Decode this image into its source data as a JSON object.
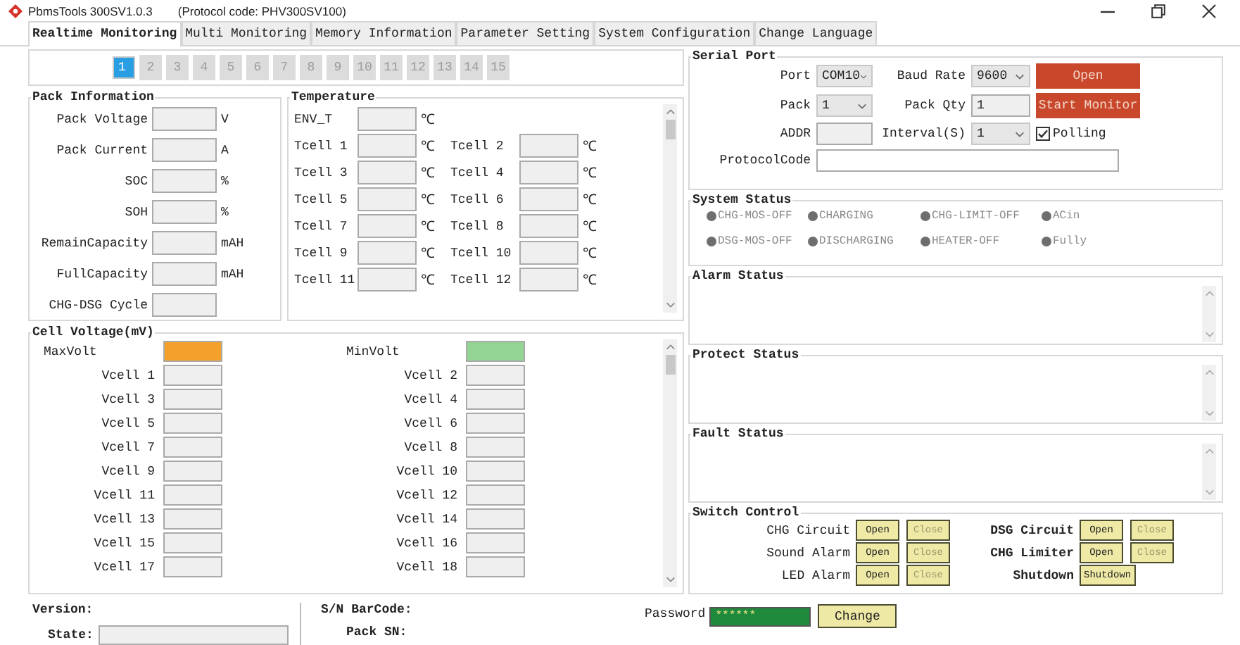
{
  "window": {
    "title": "PbmsTools 300SV1.0.3",
    "protocol": "(Protocol code: PHV300SV100)"
  },
  "tabs": [
    {
      "label": "Realtime Monitoring",
      "selected": true
    },
    {
      "label": "Multi Monitoring",
      "selected": false
    },
    {
      "label": "Memory Information",
      "selected": false
    },
    {
      "label": "Parameter Setting",
      "selected": false
    },
    {
      "label": "System Configuration",
      "selected": false
    },
    {
      "label": "Change Language",
      "selected": false
    }
  ],
  "pack_pages": [
    {
      "label": "1",
      "selected": true
    },
    {
      "label": "2",
      "selected": false
    },
    {
      "label": "3",
      "selected": false
    },
    {
      "label": "4",
      "selected": false
    },
    {
      "label": "5",
      "selected": false
    },
    {
      "label": "6",
      "selected": false
    },
    {
      "label": "7",
      "selected": false
    },
    {
      "label": "8",
      "selected": false
    },
    {
      "label": "9",
      "selected": false
    },
    {
      "label": "10",
      "selected": false
    },
    {
      "label": "11",
      "selected": false
    },
    {
      "label": "12",
      "selected": false
    },
    {
      "label": "13",
      "selected": false
    },
    {
      "label": "14",
      "selected": false
    },
    {
      "label": "15",
      "selected": false
    }
  ],
  "pack_information": {
    "title": "Pack Information",
    "fields": [
      {
        "label": "Pack Voltage",
        "unit": "V"
      },
      {
        "label": "Pack Current",
        "unit": "A"
      },
      {
        "label": "SOC",
        "unit": "%"
      },
      {
        "label": "SOH",
        "unit": "%"
      },
      {
        "label": "RemainCapacity",
        "unit": "mAH"
      },
      {
        "label": "FullCapacity",
        "unit": "mAH"
      },
      {
        "label": "CHG-DSG Cycle"
      }
    ]
  },
  "temperature": {
    "title": "Temperature",
    "rows": [
      [
        {
          "label": "ENV_T",
          "unit": "℃"
        }
      ],
      [
        {
          "label": "Tcell 1",
          "unit": "℃"
        },
        {
          "label": "Tcell 2",
          "unit": "℃"
        }
      ],
      [
        {
          "label": "Tcell 3",
          "unit": "℃"
        },
        {
          "label": "Tcell 4",
          "unit": "℃"
        }
      ],
      [
        {
          "label": "Tcell 5",
          "unit": "℃"
        },
        {
          "label": "Tcell 6",
          "unit": "℃"
        }
      ],
      [
        {
          "label": "Tcell 7",
          "unit": "℃"
        },
        {
          "label": "Tcell 8",
          "unit": "℃"
        }
      ],
      [
        {
          "label": "Tcell 9",
          "unit": "℃"
        },
        {
          "label": "Tcell 10",
          "unit": "℃"
        }
      ],
      [
        {
          "label": "Tcell 11",
          "unit": "℃"
        },
        {
          "label": "Tcell 12",
          "unit": "℃"
        }
      ]
    ]
  },
  "cell_voltage": {
    "title": "Cell Voltage(mV)",
    "max": {
      "label": "MaxVolt",
      "color": "#f4a12c"
    },
    "min": {
      "label": "MinVolt",
      "color": "#93d393"
    },
    "cells": [
      {
        "label": "Vcell 1"
      },
      {
        "label": "Vcell 2"
      },
      {
        "label": "Vcell 3"
      },
      {
        "label": "Vcell 4"
      },
      {
        "label": "Vcell 5"
      },
      {
        "label": "Vcell 6"
      },
      {
        "label": "Vcell 7"
      },
      {
        "label": "Vcell 8"
      },
      {
        "label": "Vcell 9"
      },
      {
        "label": "Vcell 10"
      },
      {
        "label": "Vcell 11"
      },
      {
        "label": "Vcell 12"
      },
      {
        "label": "Vcell 13"
      },
      {
        "label": "Vcell 14"
      },
      {
        "label": "Vcell 15"
      },
      {
        "label": "Vcell 16"
      },
      {
        "label": "Vcell 17"
      },
      {
        "label": "Vcell 18"
      }
    ]
  },
  "serial_port": {
    "title": "Serial Port",
    "port": {
      "label": "Port",
      "value": "COM10"
    },
    "baud_rate": {
      "label": "Baud Rate",
      "value": "9600"
    },
    "open_button": "Open",
    "pack": {
      "label": "Pack",
      "value": "1"
    },
    "pack_qty": {
      "label": "Pack Qty",
      "value": "1"
    },
    "start_button": "Start Monitor",
    "addr": {
      "label": "ADDR"
    },
    "interval": {
      "label": "Interval(S)",
      "value": "1"
    },
    "polling": {
      "label": "Polling",
      "checked": true
    },
    "protocol_code": {
      "label": "ProtocolCode"
    }
  },
  "system_status": {
    "title": "System Status",
    "indicators": [
      {
        "label": "CHG-MOS-OFF",
        "active": false
      },
      {
        "label": "CHARGING",
        "active": false
      },
      {
        "label": "CHG-LIMIT-OFF",
        "active": false
      },
      {
        "label": "ACin",
        "active": false
      },
      {
        "label": "DSG-MOS-OFF",
        "active": false
      },
      {
        "label": "DISCHARGING",
        "active": false
      },
      {
        "label": "HEATER-OFF",
        "active": false
      },
      {
        "label": "Fully",
        "active": false
      }
    ]
  },
  "alarm_status": {
    "title": "Alarm Status"
  },
  "protect_status": {
    "title": "Protect Status"
  },
  "fault_status": {
    "title": "Fault Status"
  },
  "switch_control": {
    "title": "Switch Control",
    "columns": [
      [
        {
          "label": "CHG Circuit",
          "buttons": [
            {
              "label": "Open",
              "disabled": false
            },
            {
              "label": "Close",
              "disabled": true
            }
          ]
        },
        {
          "label": "Sound Alarm",
          "buttons": [
            {
              "label": "Open",
              "disabled": false
            },
            {
              "label": "Close",
              "disabled": true
            }
          ]
        },
        {
          "label": "LED Alarm",
          "buttons": [
            {
              "label": "Open",
              "disabled": false
            },
            {
              "label": "Close",
              "disabled": true
            }
          ]
        }
      ],
      [
        {
          "label": "DSG Circuit",
          "buttons": [
            {
              "label": "Open",
              "disabled": false
            },
            {
              "label": "Close",
              "disabled": true
            }
          ]
        },
        {
          "label": "CHG Limiter",
          "buttons": [
            {
              "label": "Open",
              "disabled": false
            },
            {
              "label": "Close",
              "disabled": true
            }
          ]
        },
        {
          "label": "Shutdown",
          "buttons": [
            {
              "label": "Shutdown",
              "disabled": false
            }
          ]
        }
      ]
    ]
  },
  "status_bar": {
    "version_label": "Version:",
    "state_label": "State:",
    "barcode_label": "S/N BarCode:",
    "pack_sn_label": "Pack SN:",
    "password_label": "Password",
    "password_value": "******",
    "change_button": "Change"
  }
}
